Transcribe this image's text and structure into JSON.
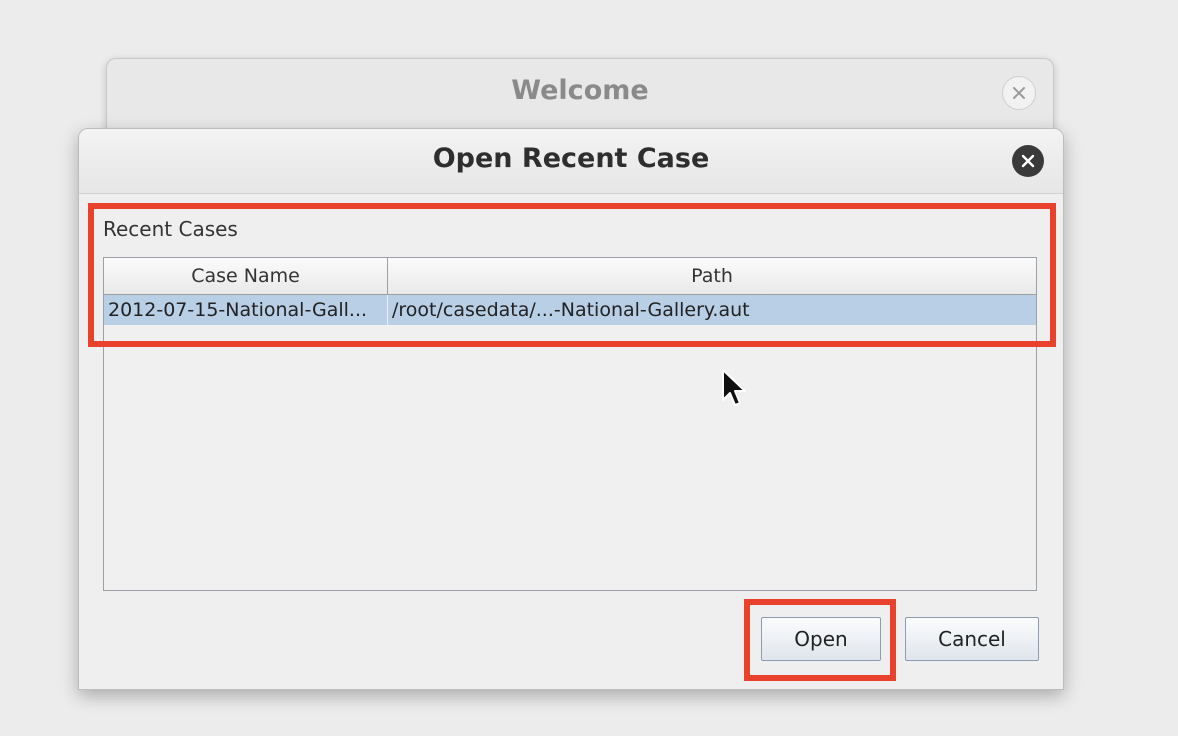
{
  "background_window": {
    "title": "Welcome",
    "close_icon": "close-icon"
  },
  "dialog": {
    "title": "Open Recent Case",
    "close_icon": "close-circle-icon",
    "section_label": "Recent Cases",
    "table": {
      "columns": [
        "Case Name",
        "Path"
      ],
      "rows": [
        {
          "case_name": "2012-07-15-National-Gall...",
          "path": "/root/casedata/...-National-Gallery.aut",
          "selected": true
        }
      ]
    },
    "buttons": {
      "open": "Open",
      "cancel": "Cancel"
    }
  },
  "colors": {
    "highlight": "#e8412c",
    "selected_row": "#b8cfe6"
  },
  "cursor_icon": "mouse-pointer-icon"
}
